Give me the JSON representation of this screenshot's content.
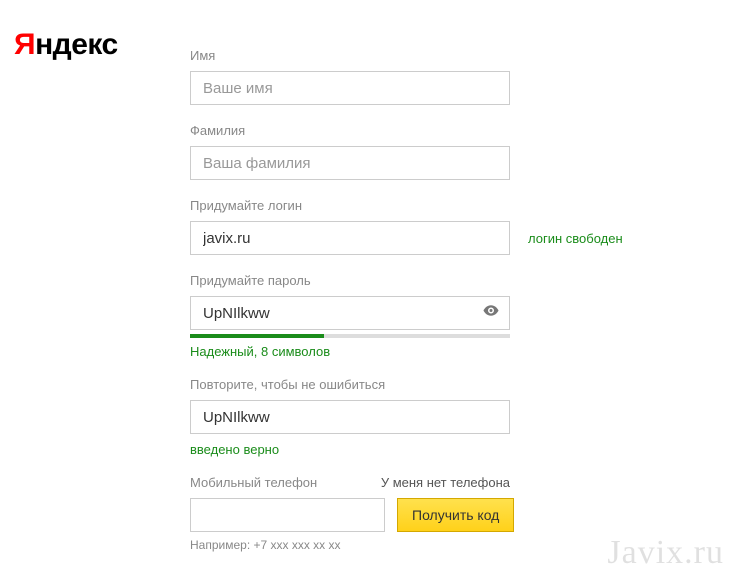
{
  "logo": {
    "first": "Я",
    "rest": "ндекс"
  },
  "fields": {
    "firstName": {
      "label": "Имя",
      "placeholder": "Ваше имя",
      "value": ""
    },
    "lastName": {
      "label": "Фамилия",
      "placeholder": "Ваша фамилия",
      "value": ""
    },
    "login": {
      "label": "Придумайте логин",
      "value": "javix.ru",
      "hint": "логин свободен"
    },
    "password": {
      "label": "Придумайте пароль",
      "value": "UpNIlkww",
      "strength": "Надежный, 8 символов"
    },
    "passwordConfirm": {
      "label": "Повторите, чтобы не ошибиться",
      "value": "UpNIlkww",
      "confirm": "введено верно"
    },
    "phone": {
      "label": "Мобильный телефон",
      "noPhoneLink": "У меня нет телефона",
      "button": "Получить код",
      "example": "Например: +7 xxx xxx xx xx"
    }
  },
  "watermark": "Javix.ru"
}
